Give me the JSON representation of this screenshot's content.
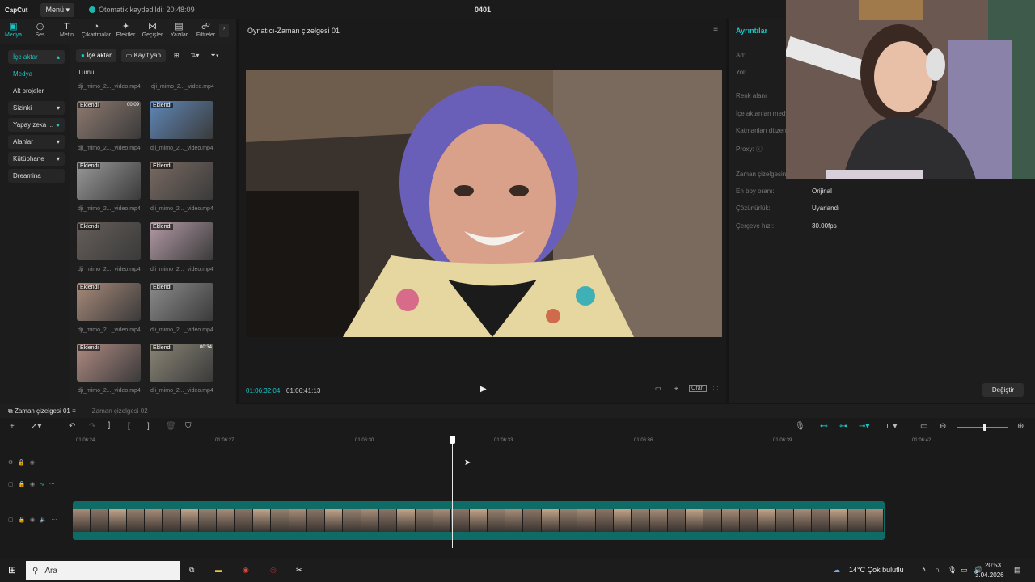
{
  "titlebar": {
    "logo": "CapCut",
    "menu_label": "Menü",
    "autosave_text": "Otomatik kaydedildi: 20:48:09",
    "project_name": "0401"
  },
  "tool_tabs": [
    {
      "label": "Medya",
      "icon": "media-icon"
    },
    {
      "label": "Ses",
      "icon": "audio-icon"
    },
    {
      "label": "Metin",
      "icon": "text-icon"
    },
    {
      "label": "Çıkartmalar",
      "icon": "sticker-icon"
    },
    {
      "label": "Efektler",
      "icon": "effects-icon"
    },
    {
      "label": "Geçişler",
      "icon": "transitions-icon"
    },
    {
      "label": "Yazılar",
      "icon": "captions-icon"
    },
    {
      "label": "Filtreler",
      "icon": "filters-icon"
    }
  ],
  "side_nav": {
    "import": "İçe aktar",
    "media": "Medya",
    "subprojects": "Alt projeler",
    "yours": "Sizinki",
    "ai": "Yapay zeka ...",
    "spaces": "Alanlar",
    "library": "Kütüphane",
    "dreamina": "Dreamina"
  },
  "media_panel": {
    "import_btn": "İçe aktar",
    "record_btn": "Kayıt yap",
    "all_label": "Tümü",
    "added_badge": "Eklendi",
    "items": [
      {
        "name": "dji_mimo_2..._video.mp4",
        "duration": "00:09"
      },
      {
        "name": "dji_mimo_2..._video.mp4",
        "duration": ""
      },
      {
        "name": "dji_mimo_2..._video.mp4",
        "duration": ""
      },
      {
        "name": "dji_mimo_2..._video.mp4",
        "duration": ""
      },
      {
        "name": "dji_mimo_2..._video.mp4",
        "duration": ""
      },
      {
        "name": "dji_mimo_2..._video.mp4",
        "duration": ""
      },
      {
        "name": "dji_mimo_2..._video.mp4",
        "duration": ""
      },
      {
        "name": "dji_mimo_2..._video.mp4",
        "duration": ""
      },
      {
        "name": "dji_mimo_2..._video.mp4",
        "duration": ""
      },
      {
        "name": "dji_mimo_2..._video.mp4",
        "duration": "00:34"
      }
    ],
    "top_labels": [
      "dji_mimo_2..._video.mp4",
      "dji_mimo_2..._video.mp4"
    ]
  },
  "player": {
    "title": "Oynatıcı-Zaman çizelgesi 01",
    "current_time": "01:06:32:04",
    "total_time": "01:06:41:13",
    "ratio_label": "Oran"
  },
  "details": {
    "title": "Ayrıntılar",
    "rows": {
      "name": "Ad:",
      "path": "Yol:",
      "color_space": "Renk alanı",
      "imported_media": "İçe aktarılan medya",
      "layer_order": "Katmanları düzenle",
      "proxy": "Proxy: ⓘ",
      "timeline": "Zaman çizelgesinin",
      "aspect": "En boy oranı:",
      "resolution": "Çözünürlük:",
      "framerate": "Çerçeve hızı:"
    },
    "values": {
      "aspect": "Orijinal",
      "resolution": "Uyarlandı",
      "framerate": "30.00fps"
    },
    "change_btn": "Değiştir"
  },
  "timeline": {
    "tab1": "Zaman çizelgesi 01",
    "tab2": "Zaman çizelgesi 02",
    "ticks": [
      "01:06:24",
      "01:06:27",
      "01:06:30",
      "01:06:33",
      "01:06:36",
      "01:06:39",
      "01:06:42"
    ]
  },
  "taskbar": {
    "search": "Ara",
    "weather": "14°C  Çok bulutlu",
    "time": "20:53",
    "date": "3.04.2026"
  },
  "colors": {
    "accent": "#19c5c5",
    "clip": "#0f6b66"
  }
}
